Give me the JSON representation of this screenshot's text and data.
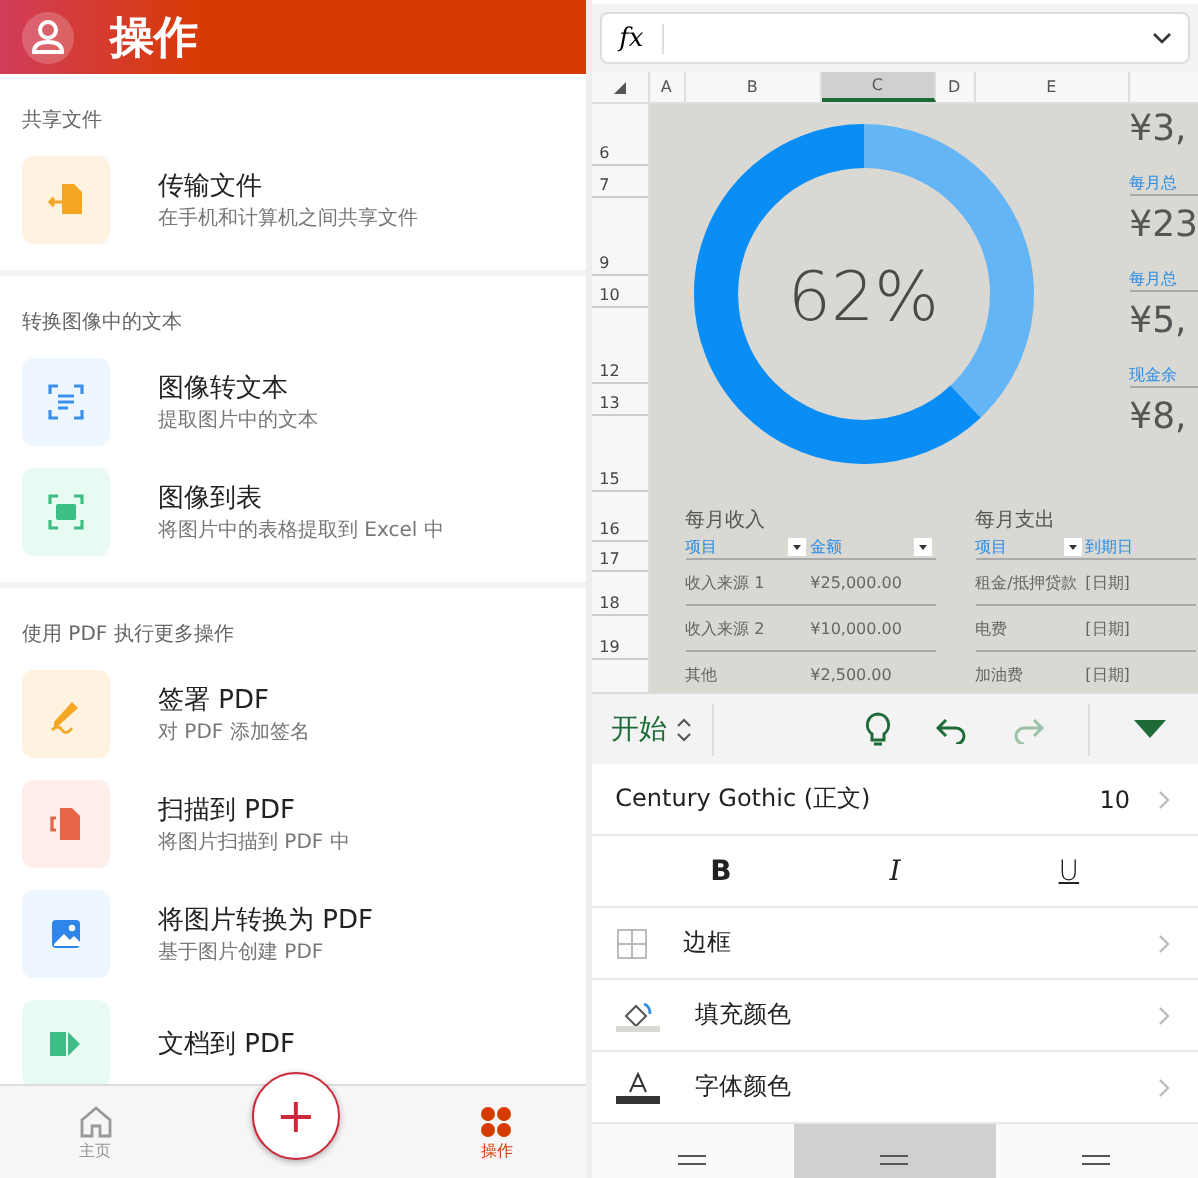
{
  "header": {
    "title": "操作"
  },
  "sections": [
    {
      "heading": "共享文件",
      "items": [
        {
          "kind": "transfer",
          "title": "传输文件",
          "subtitle": "在手机和计算机之间共享文件"
        }
      ]
    },
    {
      "heading": "转换图像中的文本",
      "items": [
        {
          "kind": "image_text",
          "title": "图像转文本",
          "subtitle": "提取图片中的文本"
        },
        {
          "kind": "image_table",
          "title": "图像到表",
          "subtitle": "将图片中的表格提取到 Excel 中"
        }
      ]
    },
    {
      "heading": "使用 PDF 执行更多操作",
      "items": [
        {
          "kind": "sign",
          "title": "签署 PDF",
          "subtitle": "对 PDF 添加签名"
        },
        {
          "kind": "scan",
          "title": "扫描到 PDF",
          "subtitle": "将图片扫描到 PDF 中"
        },
        {
          "kind": "picture_pdf",
          "title": "将图片转换为 PDF",
          "subtitle": "基于图片创建 PDF"
        },
        {
          "kind": "doc_pdf",
          "title": "文档到 PDF"
        }
      ]
    }
  ],
  "bottom_nav": [
    {
      "kind": "home",
      "label": "主页",
      "selected": false
    },
    {
      "kind": "add",
      "label": "+",
      "selected": false
    },
    {
      "kind": "actions",
      "label": "操作",
      "selected": true
    }
  ],
  "formula_bar": {
    "label": "fx"
  },
  "sheet": {
    "columns": [
      {
        "label": "A",
        "selected": false
      },
      {
        "label": "B",
        "selected": false
      },
      {
        "label": "C",
        "selected": true
      },
      {
        "label": "D",
        "selected": false
      },
      {
        "label": "E",
        "selected": false
      }
    ],
    "rows": [
      "6",
      "7",
      "9",
      "10",
      "12",
      "13",
      "15",
      "16",
      "17",
      "18",
      "19"
    ],
    "progress": {
      "level": 0.62,
      "reading": "62%"
    },
    "summary": [
      {
        "kind": "value",
        "text": "¥3,"
      },
      {
        "kind": "label",
        "text": "每月总"
      },
      {
        "kind": "value",
        "text": "¥23"
      },
      {
        "kind": "label",
        "text": "每月总"
      },
      {
        "kind": "value",
        "text": "¥5,"
      },
      {
        "kind": "label",
        "text": "现金余"
      },
      {
        "kind": "value",
        "text": "¥8,"
      }
    ],
    "tables": [
      {
        "title": "每月收入",
        "columns": [
          "项目",
          "金额"
        ],
        "rows": [
          [
            "收入来源 1",
            "¥25,000.00"
          ],
          [
            "收入来源 2",
            "¥10,000.00"
          ],
          [
            "其他",
            "¥2,500.00"
          ]
        ]
      },
      {
        "title": "每月支出",
        "columns": [
          "项目",
          "到期日"
        ],
        "rows": [
          [
            "租金/抵押贷款",
            "[日期]"
          ],
          [
            "电费",
            "[日期]"
          ],
          [
            "加油费",
            "[日期]"
          ]
        ]
      }
    ]
  },
  "toolbar": {
    "tab": "开始",
    "redo_disabled": true
  },
  "format_panel": {
    "font": "Century Gothic (正文)",
    "size": "10",
    "styles": [
      {
        "kind": "bold",
        "label": "B"
      },
      {
        "kind": "italic",
        "label": "I"
      },
      {
        "kind": "underline",
        "label": "U"
      }
    ],
    "items": [
      {
        "kind": "borders",
        "label": "边框"
      },
      {
        "kind": "fill",
        "label": "填充颜色"
      },
      {
        "kind": "font_color",
        "label": "字体颜色"
      }
    ]
  },
  "alignment": [
    {
      "selected": false
    },
    {
      "selected": true
    },
    {
      "selected": false
    }
  ]
}
